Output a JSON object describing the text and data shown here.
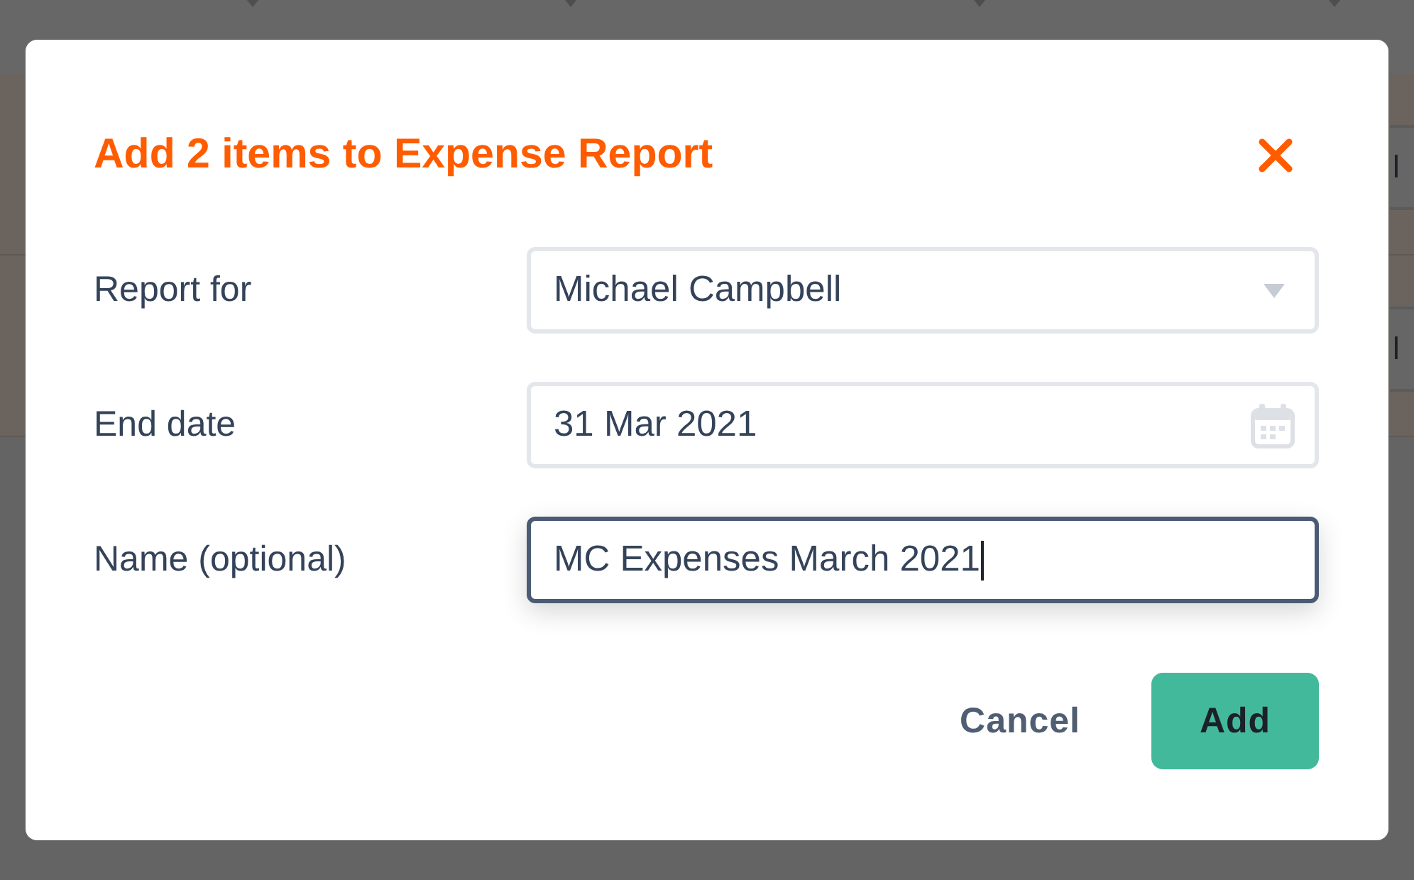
{
  "table": {
    "rows": [
      {
        "button": "l"
      },
      {
        "button": "l"
      }
    ]
  },
  "dialog": {
    "title": "Add 2 items to Expense Report",
    "fields": [
      {
        "kind": "select",
        "label": "Report for",
        "value": "Michael Campbell",
        "focused": false
      },
      {
        "kind": "date",
        "label": "End date",
        "value": "31 Mar 2021",
        "focused": false
      },
      {
        "kind": "text",
        "label": "Name (optional)",
        "value": "MC Expenses March 2021",
        "focused": true
      }
    ],
    "buttons": [
      {
        "kind": "secondary",
        "label": "Cancel"
      },
      {
        "kind": "primary",
        "label": "Add"
      }
    ]
  }
}
